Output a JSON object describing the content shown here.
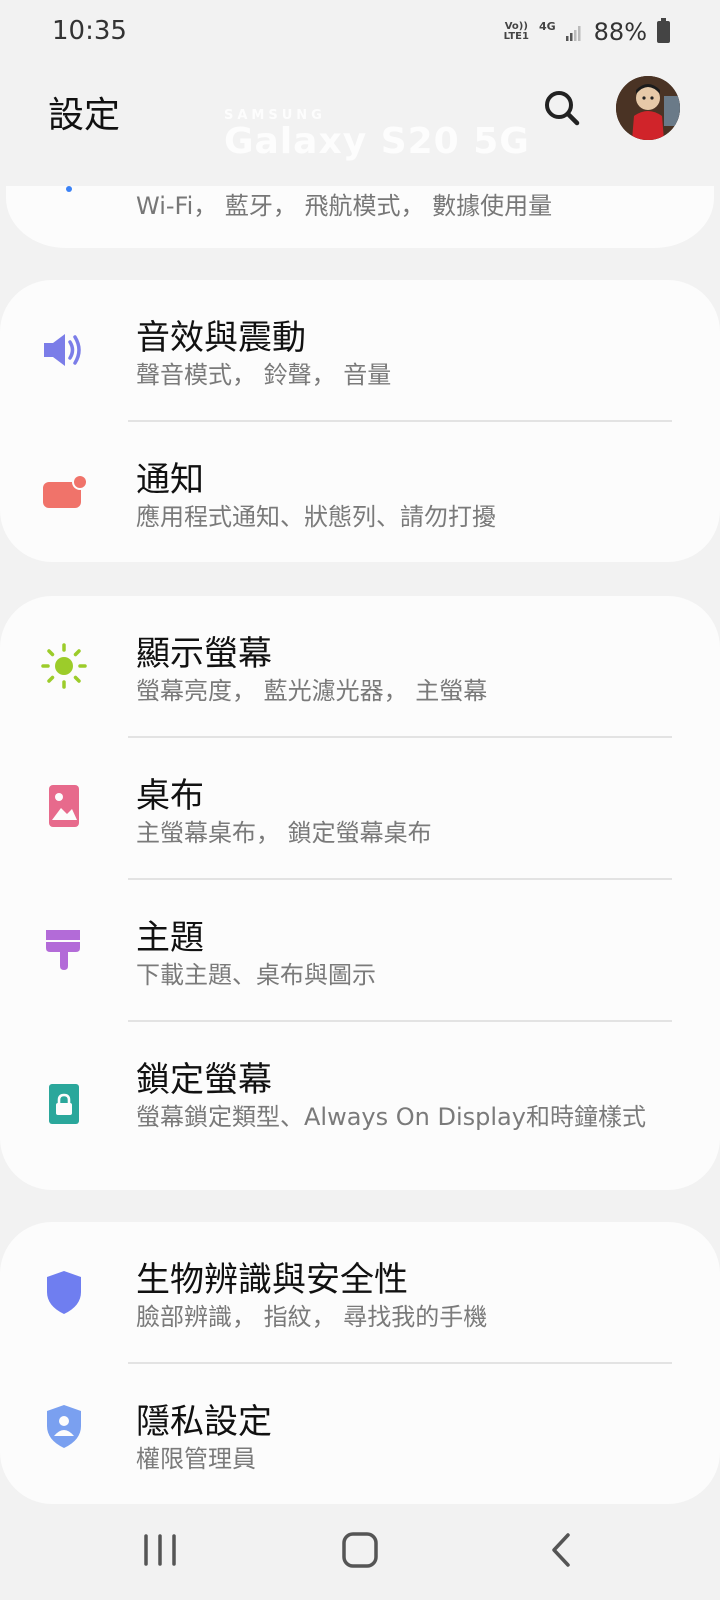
{
  "status": {
    "time": "10:35",
    "volte_top": "Vo))",
    "volte_bottom": "LTE1",
    "network": "4G",
    "battery": "88%"
  },
  "header": {
    "title": "設定",
    "watermark_brand": "SAMSUNG",
    "watermark_model": "Galaxy S20 5G"
  },
  "partial_item": {
    "subtitle": "Wi-Fi， 藍牙， 飛航模式， 數據使用量"
  },
  "cards": [
    {
      "items": [
        {
          "title": "音效與震動",
          "subtitle": "聲音模式， 鈴聲， 音量",
          "icon": "volume-icon",
          "color": "#7b7de8"
        },
        {
          "title": "通知",
          "subtitle": "應用程式通知、狀態列、請勿打擾",
          "icon": "notification-icon",
          "color": "#f0736a"
        }
      ]
    },
    {
      "items": [
        {
          "title": "顯示螢幕",
          "subtitle": "螢幕亮度， 藍光濾光器， 主螢幕",
          "icon": "brightness-icon",
          "color": "#9ccc2a"
        },
        {
          "title": "桌布",
          "subtitle": "主螢幕桌布， 鎖定螢幕桌布",
          "icon": "wallpaper-icon",
          "color": "#e76a8c"
        },
        {
          "title": "主題",
          "subtitle": "下載主題、桌布與圖示",
          "icon": "theme-icon",
          "color": "#b36bd8"
        },
        {
          "title": "鎖定螢幕",
          "subtitle": "螢幕鎖定類型、Always On Display和時鐘樣式",
          "icon": "lock-screen-icon",
          "color": "#2aa79b"
        }
      ]
    },
    {
      "items": [
        {
          "title": "生物辨識與安全性",
          "subtitle": "臉部辨識， 指紋， 尋找我的手機",
          "icon": "shield-icon",
          "color": "#6f7ef0"
        },
        {
          "title": "隱私設定",
          "subtitle": "權限管理員",
          "icon": "privacy-icon",
          "color": "#7aa0f0"
        }
      ]
    }
  ],
  "nav": {
    "recent": "recent-apps-icon",
    "home": "home-icon",
    "back": "back-icon"
  }
}
